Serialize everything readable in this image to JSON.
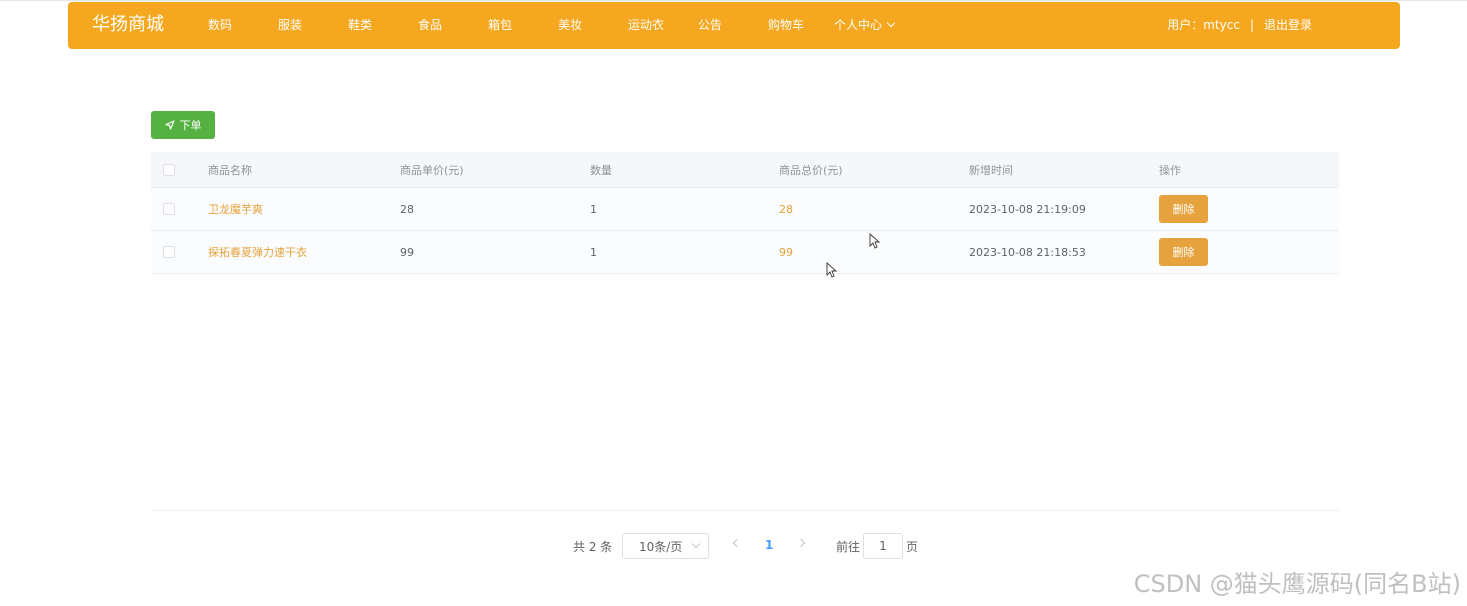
{
  "header": {
    "brand": "华扬商城",
    "nav": [
      "数码",
      "服装",
      "鞋类",
      "食品",
      "箱包",
      "美妆",
      "运动衣",
      "公告",
      "购物车",
      "个人中心"
    ],
    "user_label": "用户：mtycc",
    "separator": "|",
    "logout": "退出登录"
  },
  "toolbar": {
    "order_label": "下单"
  },
  "table": {
    "columns": [
      "商品名称",
      "商品单价(元)",
      "数量",
      "商品总价(元)",
      "新增时间",
      "操作"
    ],
    "rows": [
      {
        "name": "卫龙魔芋爽",
        "price": "28",
        "qty": "1",
        "total": "28",
        "time": "2023-10-08 21:19:09",
        "action": "删除"
      },
      {
        "name": "探拓春夏弹力速干衣",
        "price": "99",
        "qty": "1",
        "total": "99",
        "time": "2023-10-08 21:18:53",
        "action": "删除"
      }
    ]
  },
  "pagination": {
    "total_text": "共 2 条",
    "page_size": "10条/页",
    "current_page": "1",
    "goto_label": "前往",
    "goto_value": "1",
    "page_suffix": "页"
  },
  "watermark": "CSDN @猫头鹰源码(同名B站)",
  "colors": {
    "header_bg": "#f5a81f",
    "order_btn": "#55b242",
    "delete_btn": "#e6a23c",
    "link": "#e6a23c",
    "active_page": "#409eff"
  },
  "icons": {
    "order": "send-icon",
    "nav_dropdown": "chevron-down-icon"
  }
}
